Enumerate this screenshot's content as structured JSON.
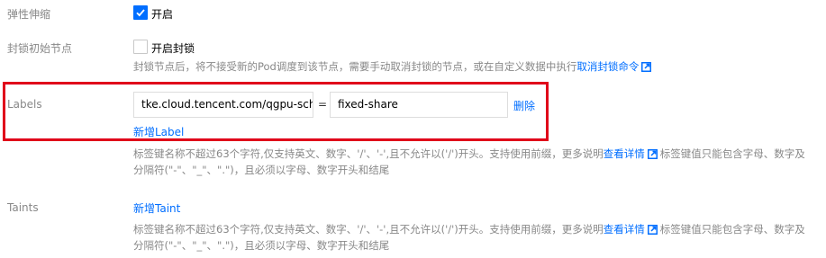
{
  "elastic": {
    "label": "弹性伸缩",
    "checkbox_label": "开启",
    "checked": true
  },
  "cordon": {
    "label": "封锁初始节点",
    "checkbox_label": "开启封锁",
    "checked": false,
    "help_text": "封锁节点后，将不接受新的Pod调度到该节点，需要手动取消封锁的节点，或在自定义数据中执行",
    "help_link": "取消封锁命令"
  },
  "labels": {
    "label": "Labels",
    "key_value": "tke.cloud.tencent.com/qgpu-schedule-policy",
    "equals": "=",
    "value_value": "fixed-share",
    "delete_label": "删除",
    "add_label": "新增Label",
    "help_line1_a": "标签键名称不超过63个字符,仅支持英文、数字、'/'、'-',且不允许以('/')开头。支持使用前缀，更多说明",
    "help_line1_link": "查看详情",
    "help_line1_b": "标签键值只能包含字母、数字及",
    "help_line2": "分隔符(\"-\"、\"_\"、\".\")，且必须以字母、数字开头和结尾"
  },
  "taints": {
    "label": "Taints",
    "add_label": "新增Taint",
    "help_line1_a": "标签键名称不超过63个字符,仅支持英文、数字、'/'、'-',且不允许以('/')开头。支持使用前缀，更多说明",
    "help_line1_link": "查看详情",
    "help_line1_b": "标签键值只能包含字母、数字及",
    "help_line2": "分隔符(\"-\"、\"_\"、\".\")，且必须以字母、数字开头和结尾"
  },
  "colors": {
    "accent": "#006eff",
    "highlight": "#e0001a"
  }
}
